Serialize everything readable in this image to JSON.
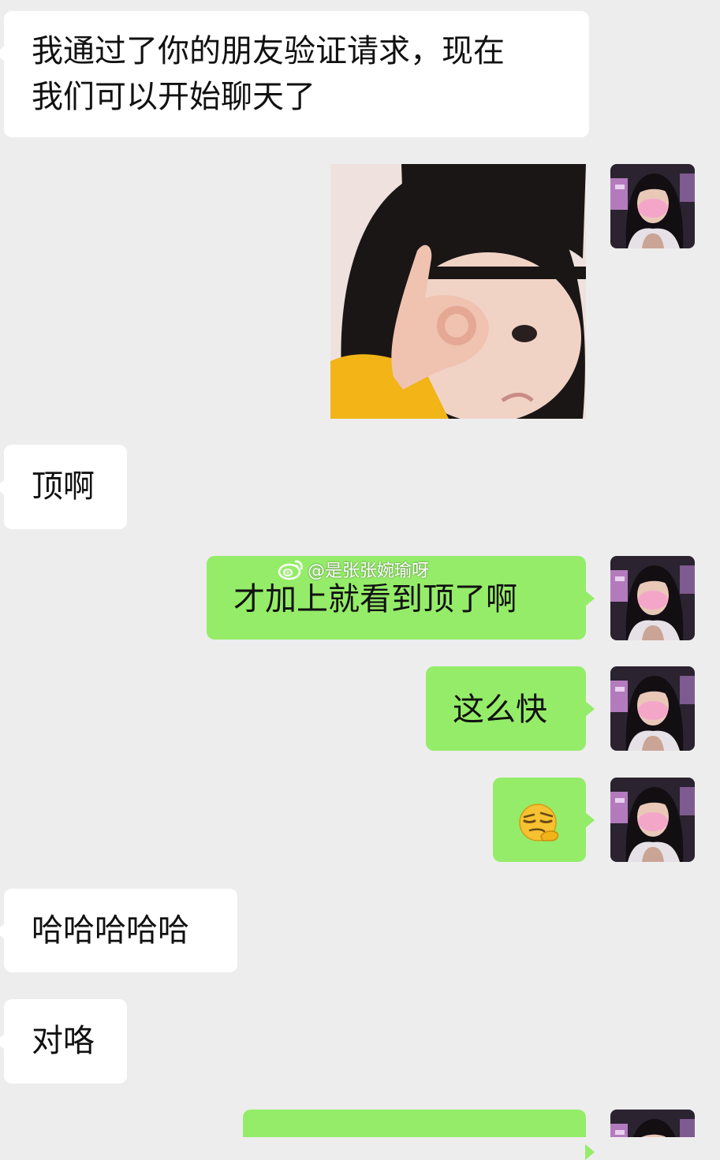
{
  "colors": {
    "background": "#ededed",
    "bubble_incoming": "#ffffff",
    "bubble_outgoing": "#95ec69"
  },
  "messages": [
    {
      "sender": "friend",
      "type": "text",
      "text": "我通过了你的朋友验证请求，现在\n我们可以开始聊天了"
    },
    {
      "sender": "me",
      "type": "sticker",
      "sticker": "girl-ok-hand-sticker"
    },
    {
      "sender": "friend",
      "type": "text",
      "text": "顶啊"
    },
    {
      "sender": "me",
      "type": "text",
      "text": "才加上就看到顶了啊"
    },
    {
      "sender": "me",
      "type": "text",
      "text": "这么快"
    },
    {
      "sender": "me",
      "type": "emoji",
      "emoji": "thinking-smirk-emoji"
    },
    {
      "sender": "friend",
      "type": "text",
      "text": "哈哈哈哈哈"
    },
    {
      "sender": "friend",
      "type": "text",
      "text": "对咯"
    },
    {
      "sender": "me",
      "type": "text",
      "text": ""
    }
  ],
  "watermark": {
    "icon": "weibo-icon",
    "text": "@是张张婉瑜呀"
  }
}
